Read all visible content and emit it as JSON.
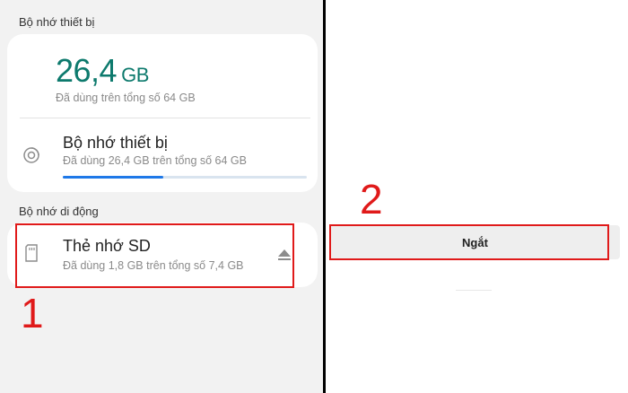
{
  "left_panel": {
    "device_section_title": "Bộ nhớ thiết bị",
    "summary": {
      "used_value": "26,4",
      "used_unit": "GB",
      "subtitle": "Đã dùng trên tổng số 64 GB"
    },
    "device_item": {
      "title": "Bộ nhớ thiết bị",
      "subtitle": "Đã dùng 26,4 GB trên tổng số 64 GB",
      "usage_fraction": 0.41
    },
    "portable_section_title": "Bộ nhớ di động",
    "sd_item": {
      "title": "Thẻ nhớ SD",
      "subtitle": "Đã dùng 1,8 GB trên tổng số 7,4 GB"
    },
    "step_label": "1"
  },
  "right_panel": {
    "step_label": "2",
    "disconnect_label": "Ngắt"
  },
  "colors": {
    "accent_teal": "#0d7a6d",
    "progress_blue": "#1e78e8",
    "highlight_red": "#e01a1a"
  },
  "icons": [
    "storage-icon",
    "sd-card-icon",
    "eject-icon"
  ]
}
